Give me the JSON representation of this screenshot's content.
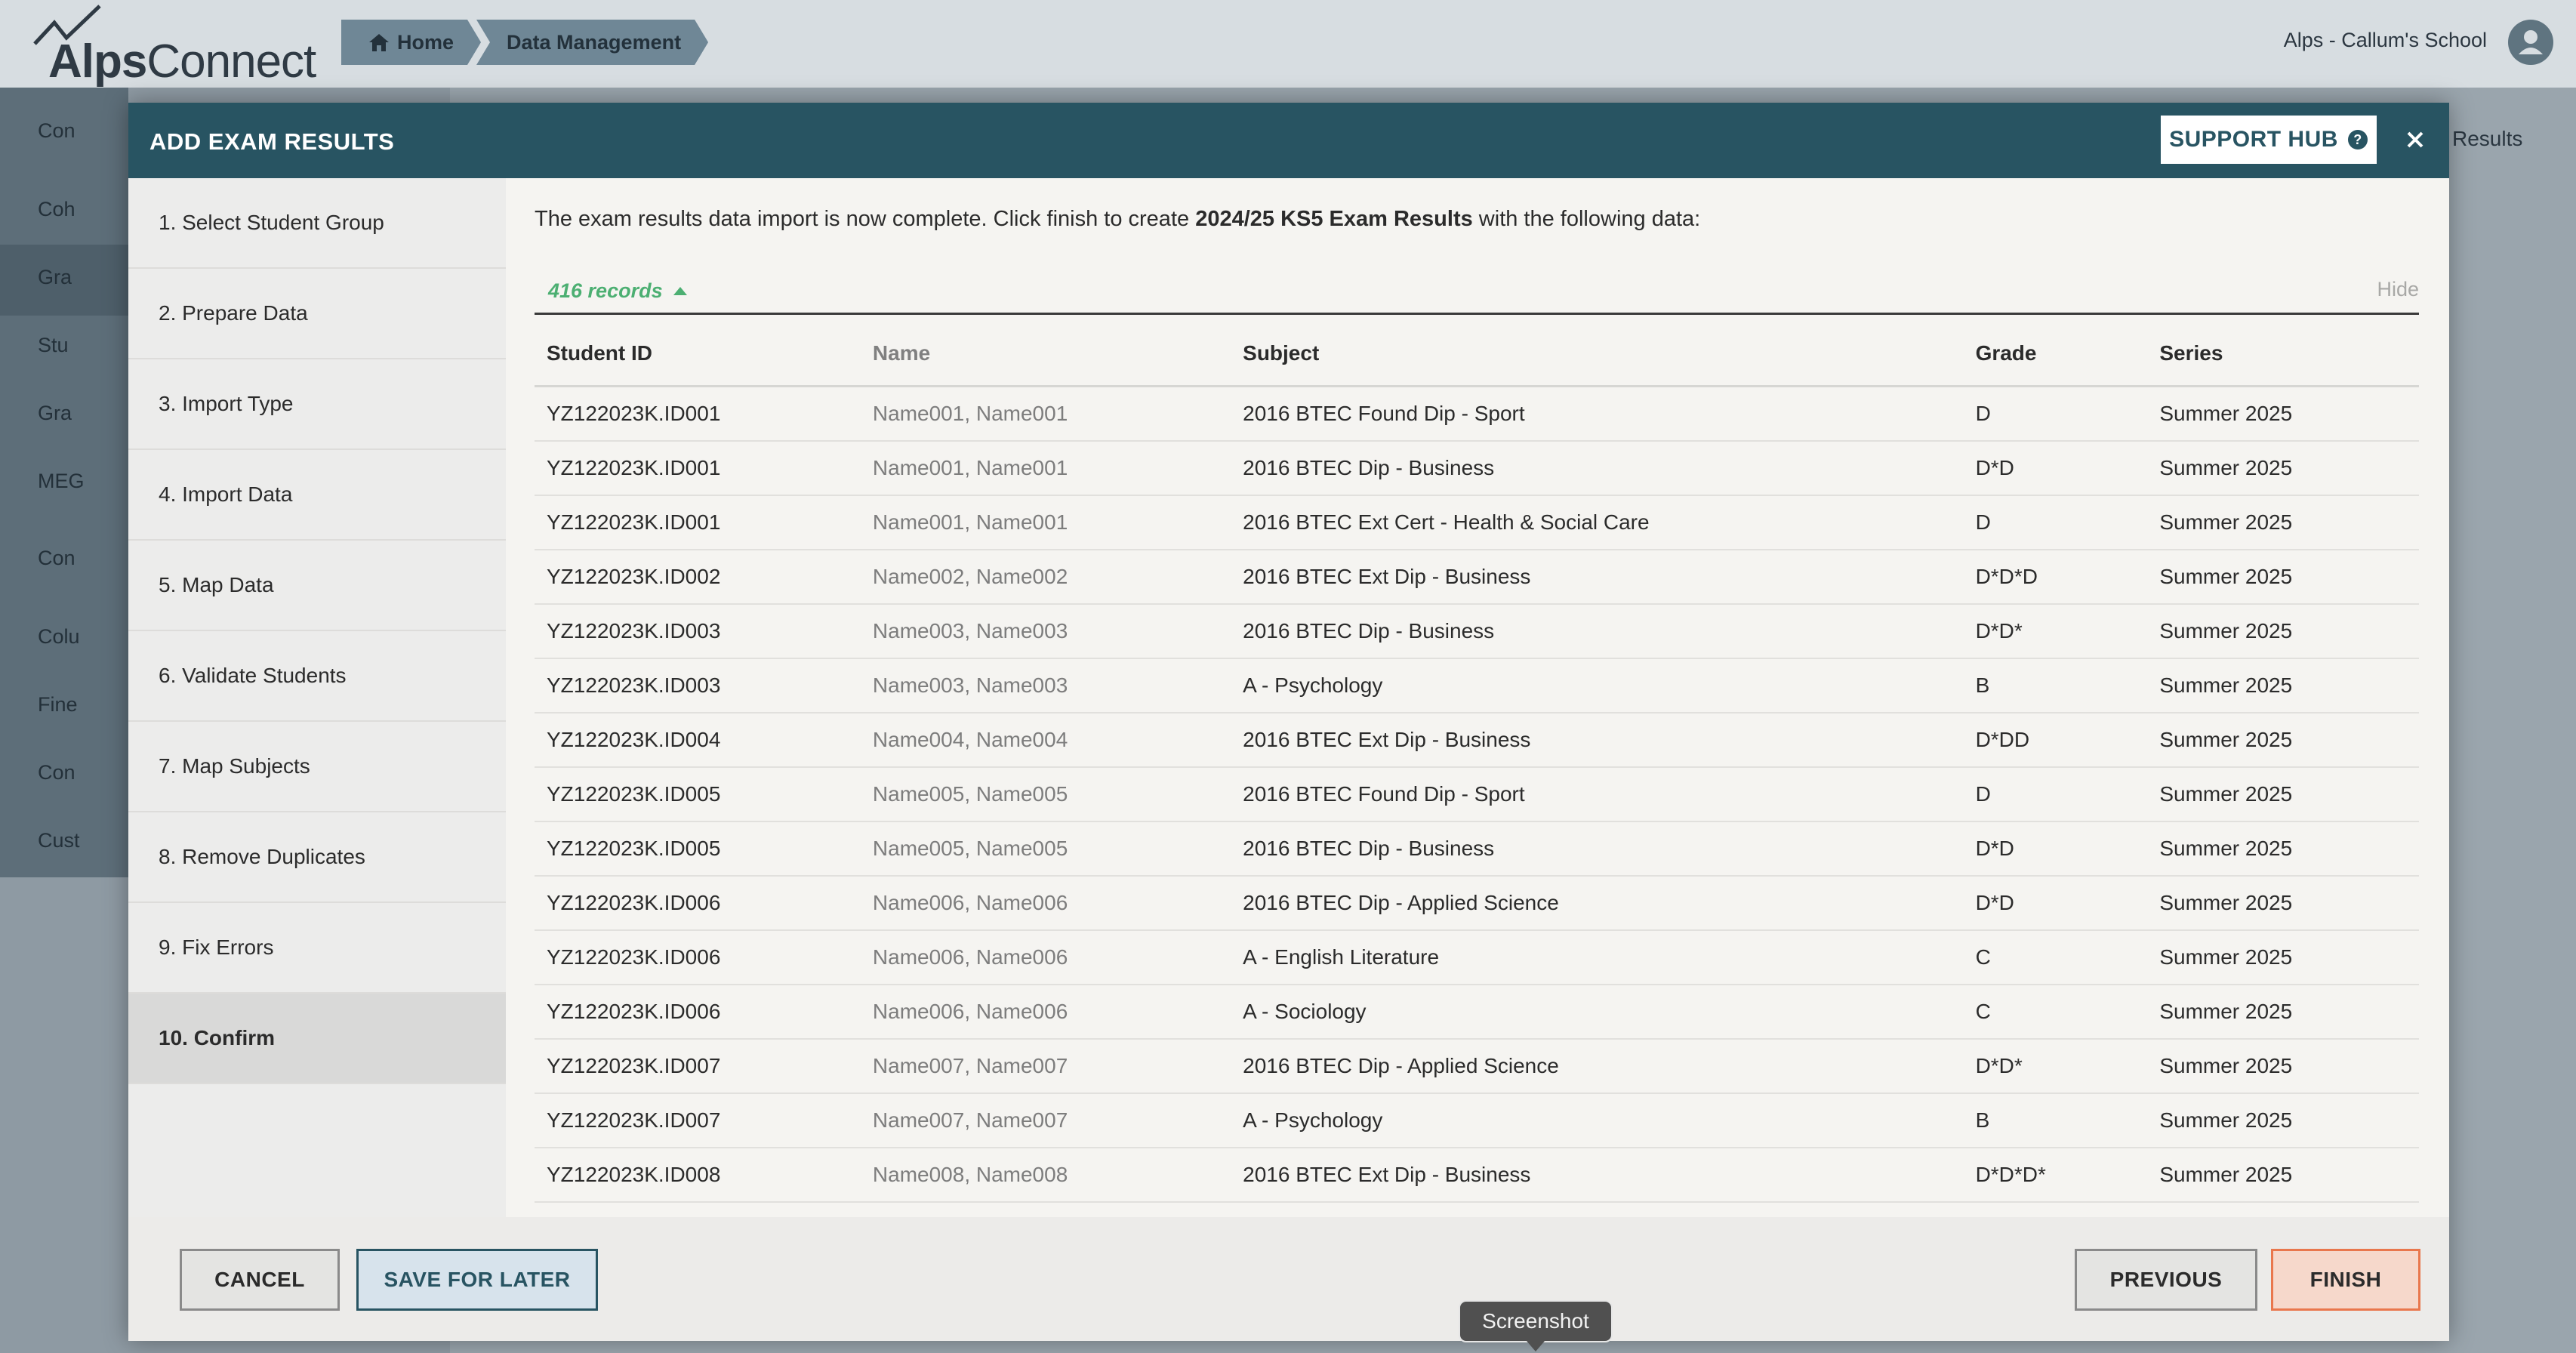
{
  "app": {
    "logo_alps": "Alps",
    "logo_connect": "Connect",
    "school_name": "Alps - Callum's School",
    "breadcrumbs": [
      {
        "label": "Home",
        "icon": "home-icon"
      },
      {
        "label": "Data Management"
      }
    ]
  },
  "background": {
    "sidebar_items": [
      "Con",
      "Coh",
      "Gra",
      "Stu",
      "Gra",
      "MEG",
      "Con",
      "Colu",
      "Fine",
      "Con",
      "Cust"
    ],
    "results_label": "Results"
  },
  "modal": {
    "title": "ADD EXAM RESULTS",
    "support_label": "SUPPORT HUB",
    "close_icon": "close-icon",
    "steps": [
      "1. Select Student Group",
      "2. Prepare Data",
      "3. Import Type",
      "4. Import Data",
      "5. Map Data",
      "6. Validate Students",
      "7. Map Subjects",
      "8. Remove Duplicates",
      "9. Fix Errors",
      "10. Confirm"
    ],
    "active_step": 9,
    "intro_before": "The exam results data import is now complete. Click finish to create ",
    "intro_bold": "2024/25 KS5 Exam Results",
    "intro_after": " with the following data:",
    "records_label": "416 records",
    "hide_label": "Hide",
    "table": {
      "headers": [
        "Student ID",
        "Name",
        "Subject",
        "Grade",
        "Series"
      ],
      "rows": [
        [
          "YZ122023K.ID001",
          "Name001, Name001",
          "2016 BTEC Found Dip - Sport",
          "D",
          "Summer 2025"
        ],
        [
          "YZ122023K.ID001",
          "Name001, Name001",
          "2016 BTEC Dip - Business",
          "D*D",
          "Summer 2025"
        ],
        [
          "YZ122023K.ID001",
          "Name001, Name001",
          "2016 BTEC Ext Cert - Health & Social Care",
          "D",
          "Summer 2025"
        ],
        [
          "YZ122023K.ID002",
          "Name002, Name002",
          "2016 BTEC Ext Dip - Business",
          "D*D*D",
          "Summer 2025"
        ],
        [
          "YZ122023K.ID003",
          "Name003, Name003",
          "2016 BTEC Dip - Business",
          "D*D*",
          "Summer 2025"
        ],
        [
          "YZ122023K.ID003",
          "Name003, Name003",
          "A - Psychology",
          "B",
          "Summer 2025"
        ],
        [
          "YZ122023K.ID004",
          "Name004, Name004",
          "2016 BTEC Ext Dip - Business",
          "D*DD",
          "Summer 2025"
        ],
        [
          "YZ122023K.ID005",
          "Name005, Name005",
          "2016 BTEC Found Dip - Sport",
          "D",
          "Summer 2025"
        ],
        [
          "YZ122023K.ID005",
          "Name005, Name005",
          "2016 BTEC Dip - Business",
          "D*D",
          "Summer 2025"
        ],
        [
          "YZ122023K.ID006",
          "Name006, Name006",
          "2016 BTEC Dip - Applied Science",
          "D*D",
          "Summer 2025"
        ],
        [
          "YZ122023K.ID006",
          "Name006, Name006",
          "A - English Literature",
          "C",
          "Summer 2025"
        ],
        [
          "YZ122023K.ID006",
          "Name006, Name006",
          "A - Sociology",
          "C",
          "Summer 2025"
        ],
        [
          "YZ122023K.ID007",
          "Name007, Name007",
          "2016 BTEC Dip - Applied Science",
          "D*D*",
          "Summer 2025"
        ],
        [
          "YZ122023K.ID007",
          "Name007, Name007",
          "A - Psychology",
          "B",
          "Summer 2025"
        ],
        [
          "YZ122023K.ID008",
          "Name008, Name008",
          "2016 BTEC Ext Dip - Business",
          "D*D*D*",
          "Summer 2025"
        ]
      ]
    },
    "footer": {
      "cancel": "CANCEL",
      "save_later": "SAVE FOR LATER",
      "previous": "PREVIOUS",
      "finish": "FINISH"
    }
  },
  "tooltip": "Screenshot",
  "colors": {
    "header_teal": "#285462",
    "records_green": "#4caf72",
    "finish_orange": "#e9774d"
  }
}
